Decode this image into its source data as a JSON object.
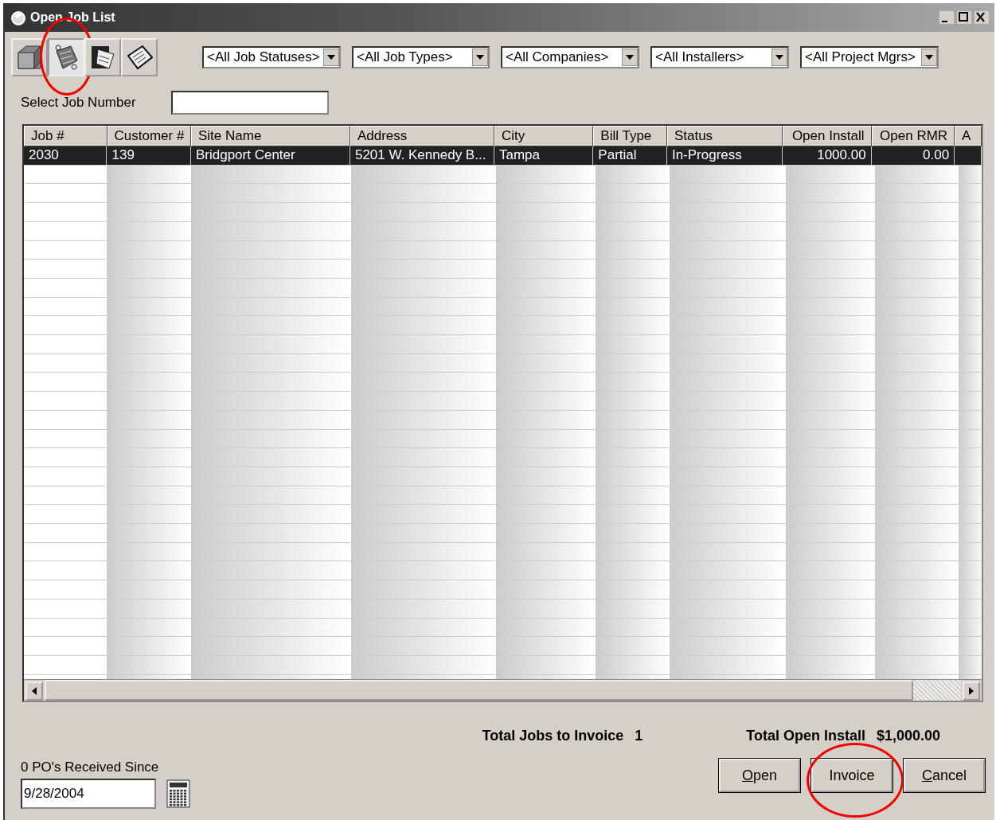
{
  "window": {
    "title": "Open Job List"
  },
  "toolbar": [
    {
      "selected": false,
      "circled": false
    },
    {
      "selected": true,
      "circled": true
    },
    {
      "selected": false,
      "circled": false
    },
    {
      "selected": false,
      "circled": false
    }
  ],
  "filters": [
    "<All Job Statuses>",
    "<All Job Types>",
    "<All Companies>",
    "<All Installers>",
    "<All Project Mgrs>"
  ],
  "job_number": {
    "label": "Select Job Number"
  },
  "table": {
    "columns": [
      "Job #",
      "Customer #",
      "Site Name",
      "Address",
      "City",
      "Bill Type",
      "Status",
      "Open Install",
      "Open RMR",
      "A"
    ],
    "rows": [
      {
        "selected": true,
        "cells": [
          "2030",
          "139",
          "Bridgport Center",
          "5201 W. Kennedy B...",
          "Tampa",
          "Partial",
          "In-Progress",
          "1000.00",
          "0.00"
        ]
      }
    ]
  },
  "totals": [
    {
      "label": "Total Jobs to Invoice",
      "value": "1"
    },
    {
      "label": "Total Open Install",
      "value": "$1,000.00"
    }
  ],
  "po": {
    "label": "0 PO's Received Since",
    "date": "9/28/2004"
  },
  "buttons": [
    {
      "label": "Open",
      "accel_first": true,
      "circled": false
    },
    {
      "label": "Invoice",
      "accel_first": false,
      "circled": true
    },
    {
      "label": "Cancel",
      "accel_first": true,
      "circled": false
    }
  ]
}
